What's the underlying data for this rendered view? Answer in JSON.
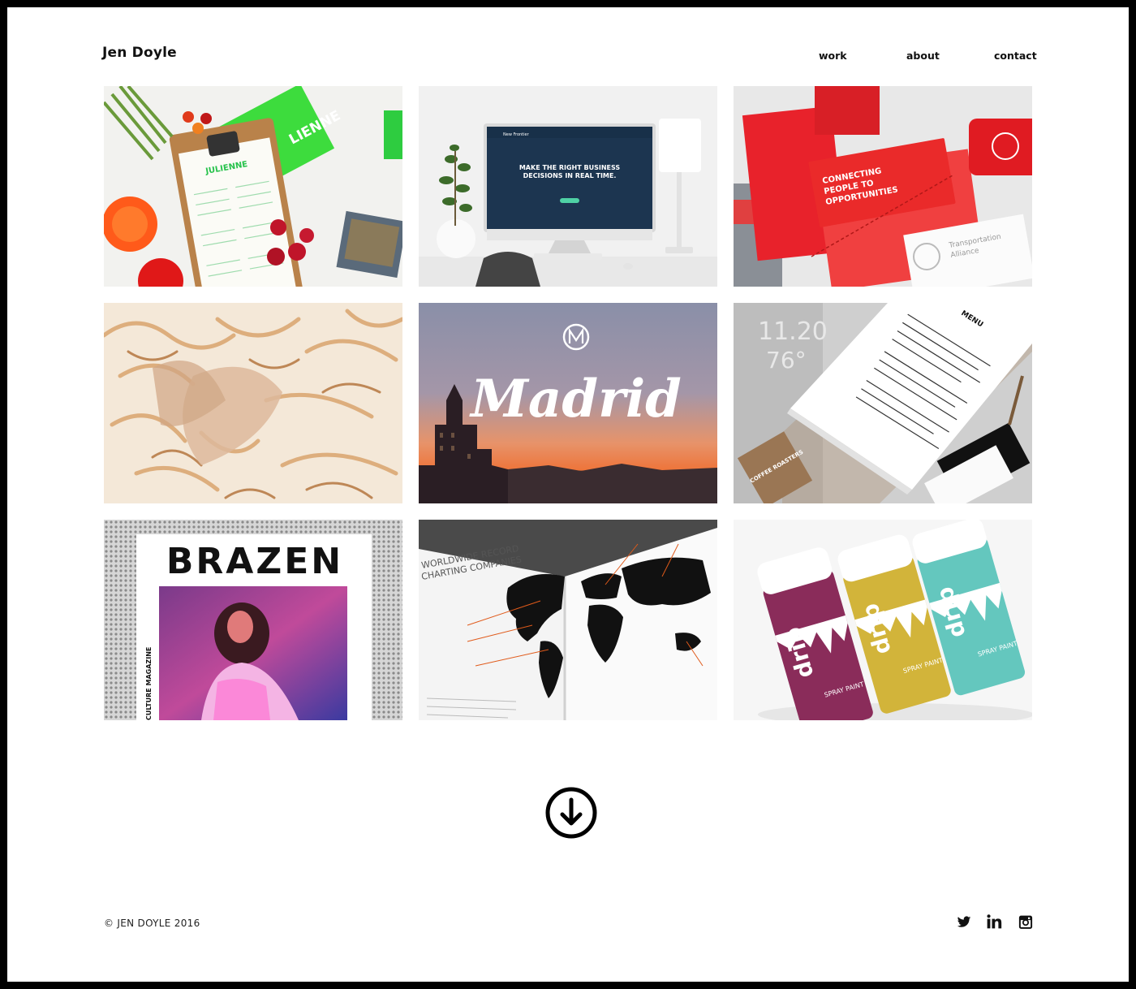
{
  "header": {
    "brand": "Jen Doyle",
    "nav": [
      {
        "label": "work"
      },
      {
        "label": "about"
      },
      {
        "label": "contact"
      }
    ]
  },
  "tiles": [
    {
      "subject": "julienne-menu-branding",
      "texts": [
        "LIENNE",
        "JULIENNE"
      ]
    },
    {
      "subject": "new-frontier-website",
      "texts": [
        "MAKE THE RIGHT BUSINESS",
        "DECISIONS IN REAL TIME.",
        "New Frontier"
      ]
    },
    {
      "subject": "transportation-alliance-stationery",
      "texts": [
        "CONNECTING",
        "PEOPLE TO",
        "OPPORTUNITIES",
        "Transportation",
        "Alliance"
      ]
    },
    {
      "subject": "wood-shavings-photo",
      "texts": []
    },
    {
      "subject": "madrid-lettering",
      "texts": [
        "Madrid"
      ]
    },
    {
      "subject": "coffee-roasters-menu",
      "texts": [
        "MENU",
        "11.20",
        "76°",
        "COFFEE ROASTERS"
      ]
    },
    {
      "subject": "brazen-magazine-cover",
      "texts": [
        "BRAZEN",
        "CULTURE MAGAZINE"
      ]
    },
    {
      "subject": "record-charting-map-book",
      "texts": [
        "WORLDWIDE RECORD",
        "CHARTING COMPANIES"
      ]
    },
    {
      "subject": "drip-spray-paint-cans",
      "texts": [
        "drip",
        "SPRAY PAINT"
      ]
    }
  ],
  "scroll_button": {
    "icon": "arrow-down-circle-icon"
  },
  "footer": {
    "copyright": "© JEN DOYLE 2016",
    "social": [
      {
        "icon": "twitter-icon"
      },
      {
        "icon": "linkedin-icon"
      },
      {
        "icon": "instagram-icon"
      }
    ]
  }
}
